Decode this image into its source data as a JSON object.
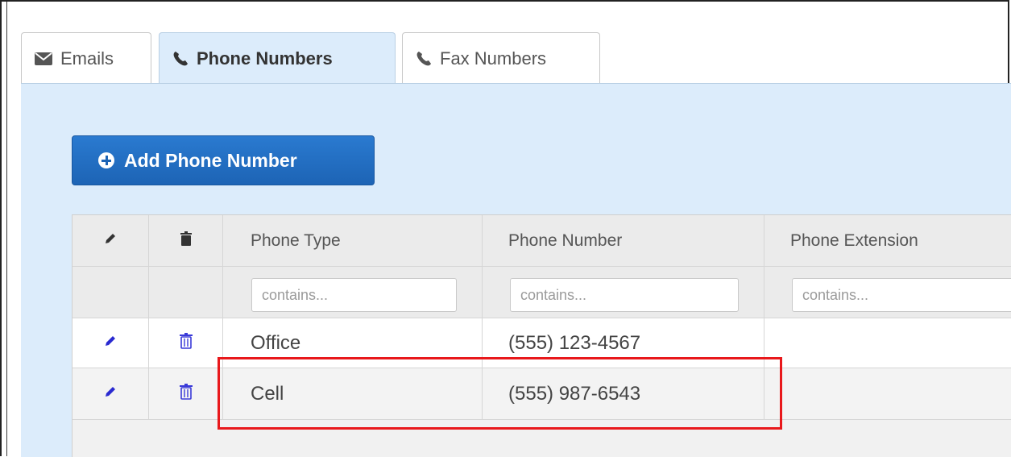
{
  "tabs": [
    {
      "label": "Emails",
      "icon": "envelope-icon",
      "active": false
    },
    {
      "label": "Phone Numbers",
      "icon": "phone-icon",
      "active": true
    },
    {
      "label": "Fax Numbers",
      "icon": "phone-icon",
      "active": false
    }
  ],
  "toolbar": {
    "add_label": "Add Phone Number",
    "add_icon": "plus-circle-icon"
  },
  "grid": {
    "columns": [
      {
        "key": "edit",
        "label": "",
        "icon": "pencil-icon"
      },
      {
        "key": "delete",
        "label": "",
        "icon": "trash-icon"
      },
      {
        "key": "type",
        "label": "Phone Type"
      },
      {
        "key": "number",
        "label": "Phone Number"
      },
      {
        "key": "extension",
        "label": "Phone Extension"
      }
    ],
    "filters": {
      "type_placeholder": "contains...",
      "number_placeholder": "contains...",
      "extension_placeholder": "contains..."
    },
    "rows": [
      {
        "type": "Office",
        "number": "(555) 123-4567",
        "extension": ""
      },
      {
        "type": "Cell",
        "number": "(555) 987-6543",
        "extension": ""
      }
    ]
  },
  "colors": {
    "accent": "#1d64b5",
    "panel_bg": "#dcecfb",
    "row_icon": "#2a2ad0",
    "highlight": "#e8181b"
  }
}
